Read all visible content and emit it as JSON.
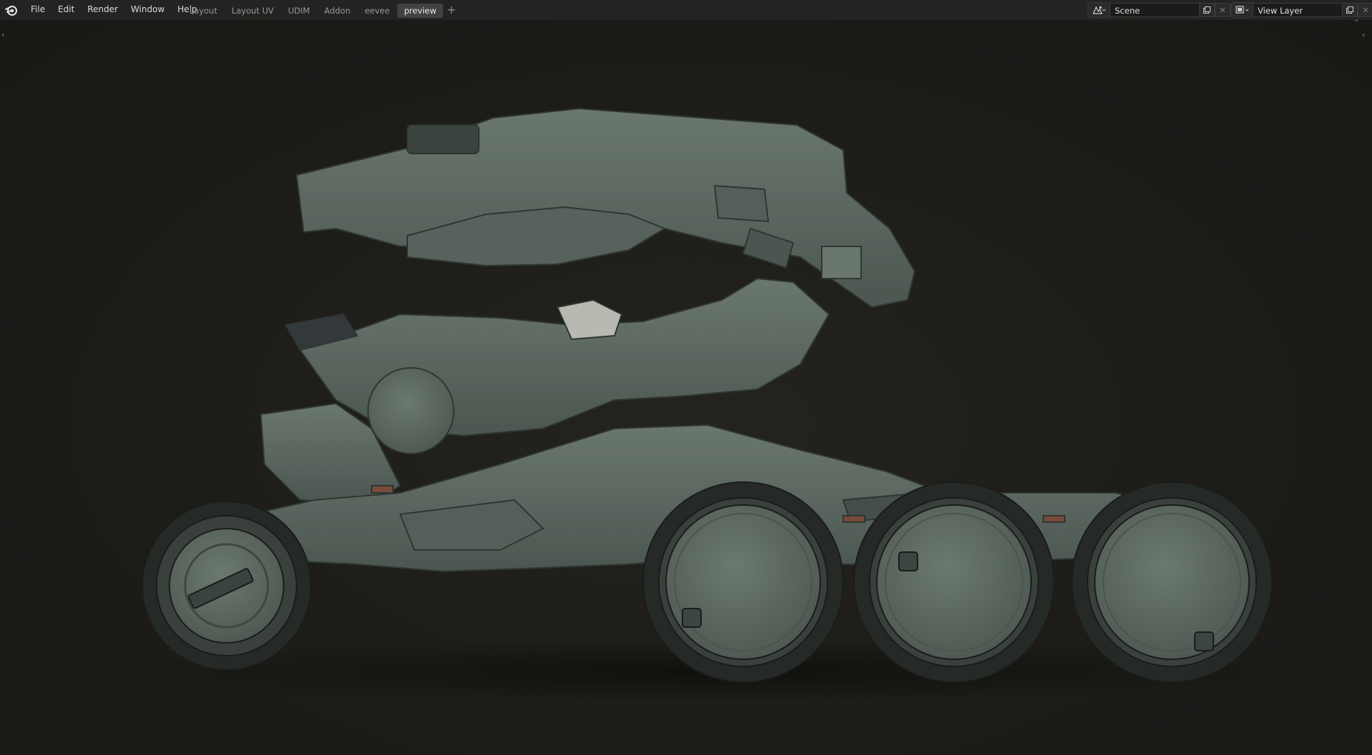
{
  "app": "Blender",
  "menu": {
    "items": [
      {
        "label": "File"
      },
      {
        "label": "Edit"
      },
      {
        "label": "Render"
      },
      {
        "label": "Window"
      },
      {
        "label": "Help"
      }
    ]
  },
  "workspaces": {
    "tabs": [
      {
        "label": "Layout"
      },
      {
        "label": "Layout UV"
      },
      {
        "label": "UDIM"
      },
      {
        "label": "Addon"
      },
      {
        "label": "eevee"
      },
      {
        "label": "preview",
        "active": true
      }
    ],
    "add_symbol": "+"
  },
  "scene": {
    "name": "Scene",
    "icon": "scene-icon"
  },
  "view_layer": {
    "name": "View Layer",
    "icon": "render-layer-icon"
  },
  "viewport": {
    "content": "rendered six-wheeled rover model with articulated arm",
    "model_color": "#5e6b63",
    "background_color": "#1d1c19"
  }
}
